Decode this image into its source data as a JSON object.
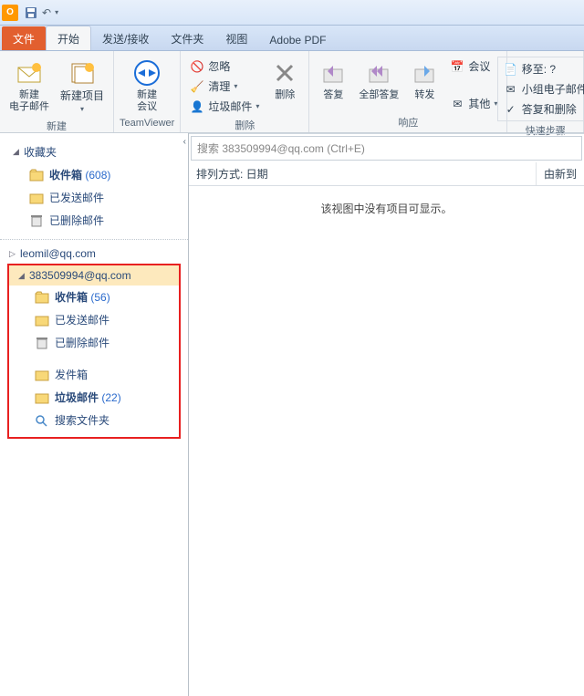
{
  "tabs": {
    "file": "文件",
    "home": "开始",
    "sendreceive": "发送/接收",
    "folder": "文件夹",
    "view": "视图",
    "pdf": "Adobe PDF"
  },
  "ribbon": {
    "new": {
      "newEmail": "新建\n电子邮件",
      "newItems": "新建项目",
      "label": "新建"
    },
    "tv": {
      "meeting": "新建\n会议",
      "label": "TeamViewer"
    },
    "delete": {
      "ignore": "忽略",
      "clean": "清理",
      "junk": "垃圾邮件",
      "del": "删除",
      "label": "删除"
    },
    "respond": {
      "reply": "答复",
      "replyAll": "全部答复",
      "forward": "转发",
      "meeting": "会议",
      "more": "其他",
      "label": "响应"
    },
    "quick": {
      "moveTo": "移至: ?",
      "team": "小组电子邮件",
      "replyDel": "答复和删除",
      "label": "快速步骤"
    }
  },
  "nav": {
    "favorites": {
      "header": "收藏夹",
      "inbox": "收件箱",
      "inboxCount": "(608)",
      "sent": "已发送邮件",
      "deleted": "已删除邮件"
    },
    "account1": "leomil@qq.com",
    "account2": {
      "header": "383509994@qq.com",
      "inbox": "收件箱",
      "inboxCount": "(56)",
      "sent": "已发送邮件",
      "deleted": "已删除邮件",
      "outbox": "发件箱",
      "junk": "垃圾邮件",
      "junkCount": "(22)",
      "search": "搜索文件夹"
    }
  },
  "content": {
    "searchPlaceholder": "搜索 383509994@qq.com (Ctrl+E)",
    "sortBy": "排列方式: 日期",
    "sortDir": "由新到",
    "empty": "该视图中没有项目可显示。"
  }
}
